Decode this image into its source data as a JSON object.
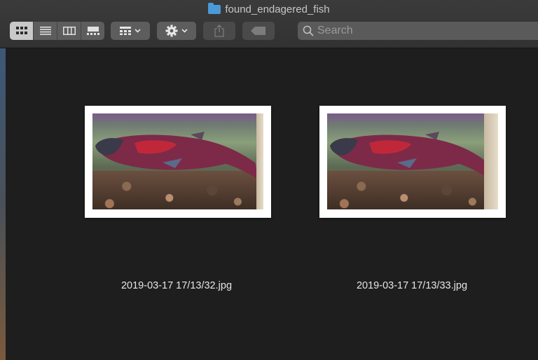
{
  "window": {
    "title": "found_endagered_fish"
  },
  "toolbar": {
    "view_modes": [
      {
        "icon": "icon-view-icon",
        "active": true
      },
      {
        "icon": "list-view-icon",
        "active": false
      },
      {
        "icon": "column-view-icon",
        "active": false
      },
      {
        "icon": "gallery-view-icon",
        "active": false
      }
    ],
    "group_icon": "group-by-icon",
    "action_icon": "gear-icon",
    "share_icon": "share-icon",
    "tag_icon": "tag-icon",
    "search_placeholder": "Search"
  },
  "files": [
    {
      "name": "2019-03-17 17/13/32.jpg",
      "thumbnail": "salmon-photo"
    },
    {
      "name": "2019-03-17 17/13/33.jpg",
      "thumbnail": "salmon-photo"
    }
  ],
  "colors": {
    "window_bg": "#1e1e1e",
    "toolbar_bg": "#353535",
    "folder_icon": "#4a9ad8",
    "fish_body": "#8a2a45",
    "fish_red": "#c0283a"
  }
}
